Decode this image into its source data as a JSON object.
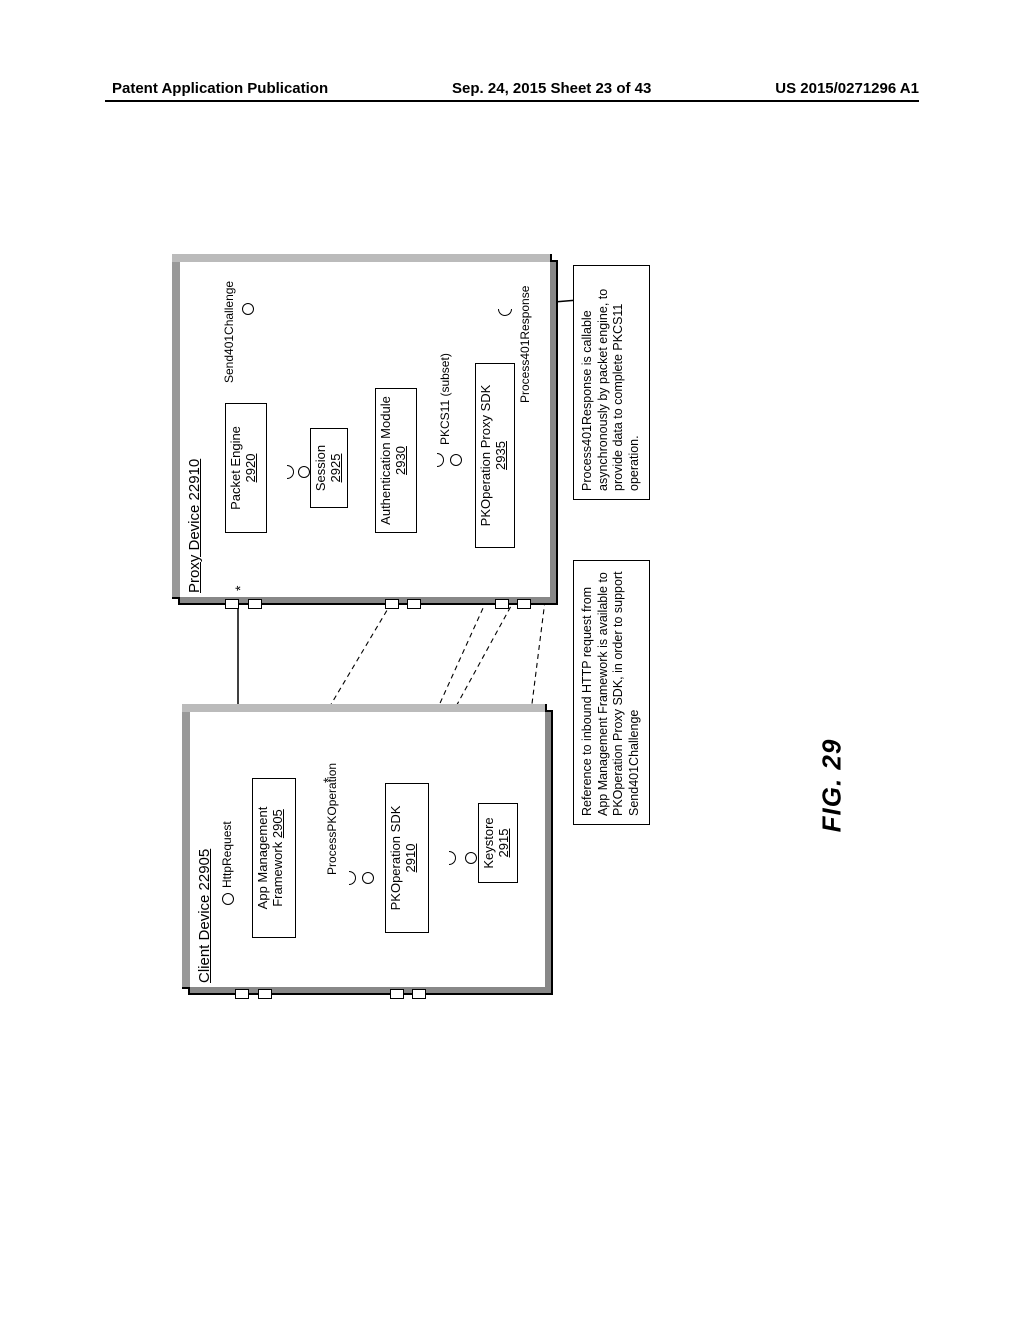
{
  "header": {
    "left": "Patent Application Publication",
    "center": "Sep. 24, 2015  Sheet 23 of 43",
    "right": "US 2015/0271296 A1"
  },
  "figure_label": "FIG. 29",
  "client": {
    "title": "Client Device 22905",
    "app_mgmt": {
      "label": "App Management Framework",
      "ref": "2905"
    },
    "pko_sdk": {
      "label": "PKOperation SDK",
      "ref": "2910"
    },
    "keystore": {
      "label": "Keystore",
      "ref": "2915"
    },
    "iface_http": "HttpRequest",
    "iface_processpko": "ProcessPKOperation"
  },
  "proxy": {
    "title": "Proxy Device 22910",
    "packet_engine": {
      "label": "Packet Engine",
      "ref": "2920"
    },
    "session": {
      "label": "Session",
      "ref": "2925"
    },
    "auth_module": {
      "label": "Authentication Module",
      "ref": "2930"
    },
    "pko_proxy_sdk": {
      "label": "PKOperation Proxy SDK",
      "ref": "2935"
    },
    "iface_send401": "Send401Challenge",
    "iface_process401": "Process401Response",
    "iface_pkcs11": "PKCS11 (subset)"
  },
  "notes": {
    "note1": "Reference to inbound HTTP request from App Management Framework is available to PKOperation Proxy SDK, in order to support Send401Challenge",
    "note2": "Process401Response is callable asynchronously by packet engine, to provide data to complete PKCS11 operation."
  },
  "multiplicity": "*"
}
